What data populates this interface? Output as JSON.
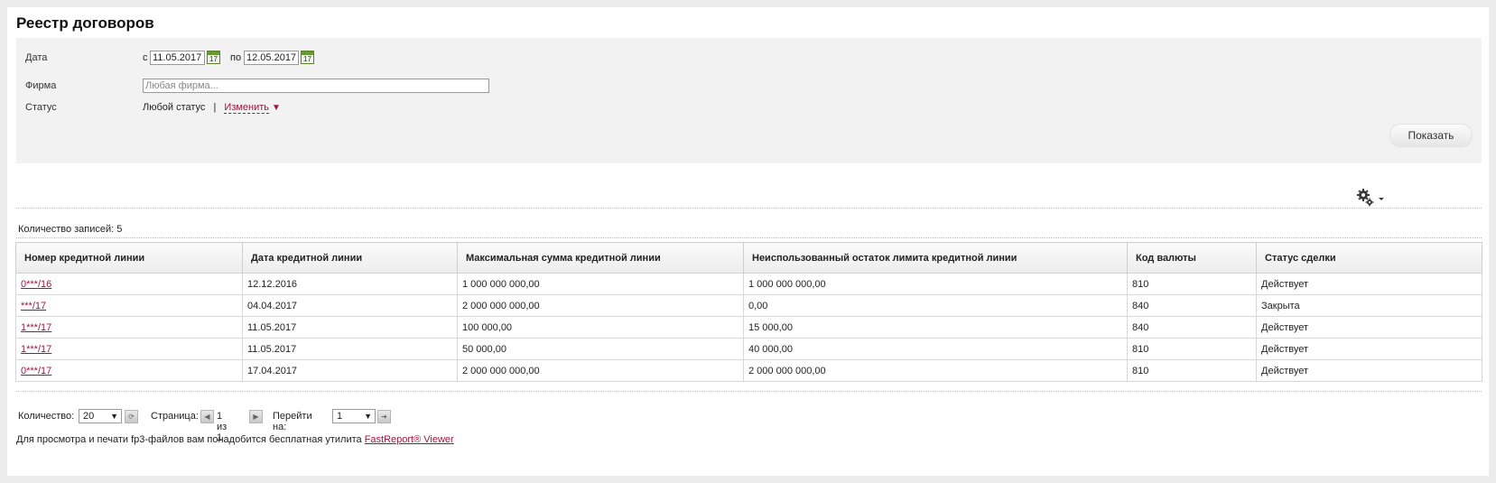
{
  "page": {
    "title": "Реестр договоров"
  },
  "filter": {
    "date_label": "Дата",
    "date_from_prefix": "с",
    "date_from": "11.05.2017",
    "date_to_prefix": "по",
    "date_to": "12.05.2017",
    "calendar_icon_text": "17",
    "firm_label": "Фирма",
    "firm_placeholder": "Любая фирма...",
    "status_label": "Статус",
    "status_value": "Любой статус",
    "status_separator": "|",
    "status_change": "Изменить",
    "show_button": "Показать"
  },
  "records": {
    "label": "Количество записей: 5"
  },
  "table": {
    "headers": [
      "Номер кредитной линии",
      "Дата кредитной линии",
      "Максимальная сумма кредитной линии",
      "Неиспользованный остаток лимита кредитной линии",
      "Код валюты",
      "Статус сделки"
    ],
    "rows": [
      [
        "0***/16",
        "12.12.2016",
        "1 000 000 000,00",
        "1 000 000 000,00",
        "810",
        "Действует"
      ],
      [
        "***/17",
        "04.04.2017",
        "2 000 000 000,00",
        "0,00",
        "840",
        "Закрыта"
      ],
      [
        "1***/17",
        "11.05.2017",
        "100 000,00",
        "15 000,00",
        "840",
        "Действует"
      ],
      [
        "1***/17",
        "11.05.2017",
        "50 000,00",
        "40 000,00",
        "810",
        "Действует"
      ],
      [
        "0***/17",
        "17.04.2017",
        "2 000 000 000,00",
        "2 000 000 000,00",
        "810",
        "Действует"
      ]
    ]
  },
  "pager": {
    "quantity_label": "Количество:",
    "quantity_value": "20",
    "page_label": "Страница:",
    "page_info": "1 из 1",
    "goto_label": "Перейти на:",
    "goto_value": "1"
  },
  "footer": {
    "text": "Для просмотра и печати fp3-файлов вам понадобится бесплатная утилита",
    "link": "FastReport® Viewer"
  },
  "colors": {
    "link": "#a0153e",
    "calendar": "#6a9a32"
  },
  "icons": [
    "calendar-icon",
    "gear-icon",
    "refresh-icon",
    "prev-page-icon",
    "next-page-icon",
    "go-icon"
  ]
}
